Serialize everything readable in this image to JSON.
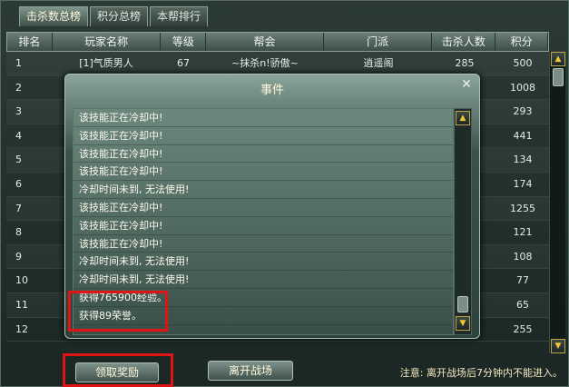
{
  "tabs": [
    {
      "label": "击杀数总榜",
      "active": true
    },
    {
      "label": "积分总榜",
      "active": false
    },
    {
      "label": "本帮排行",
      "active": false
    }
  ],
  "table": {
    "headers": [
      "排名",
      "玩家名称",
      "等级",
      "帮会",
      "门派",
      "击杀人数",
      "积分"
    ],
    "rows": [
      [
        "1",
        "[1]气质男人",
        "67",
        "~抹杀n!骄傲~",
        "逍遥阁",
        "285",
        "500"
      ],
      [
        "2",
        "",
        "",
        "",
        "",
        "",
        "1008"
      ],
      [
        "3",
        "",
        "",
        "",
        "",
        "",
        "293"
      ],
      [
        "4",
        "",
        "",
        "",
        "",
        "",
        "441"
      ],
      [
        "5",
        "",
        "",
        "",
        "",
        "",
        "134"
      ],
      [
        "6",
        "",
        "",
        "",
        "",
        "",
        "174"
      ],
      [
        "7",
        "",
        "",
        "",
        "",
        "",
        "1255"
      ],
      [
        "8",
        "",
        "",
        "",
        "",
        "",
        "121"
      ],
      [
        "9",
        "",
        "",
        "",
        "",
        "",
        "108"
      ],
      [
        "10",
        "",
        "",
        "",
        "",
        "",
        "77"
      ],
      [
        "11",
        "",
        "",
        "",
        "",
        "",
        "65"
      ],
      [
        "12",
        "",
        "",
        "",
        "",
        "",
        "255"
      ]
    ]
  },
  "modal": {
    "title": "事件",
    "close_icon": "close-icon",
    "messages": [
      "该技能正在冷却中!",
      "该技能正在冷却中!",
      "该技能正在冷却中!",
      "该技能正在冷却中!",
      "冷却时间未到, 无法使用!",
      "该技能正在冷却中!",
      "该技能正在冷却中!",
      "该技能正在冷却中!",
      "冷却时间未到, 无法使用!",
      "冷却时间未到, 无法使用!",
      "获得765900经验。",
      "获得89荣誉。"
    ]
  },
  "buttons": {
    "claim_reward": "领取奖励",
    "leave_battle": "离开战场"
  },
  "notice": "注意: 离开战场后7分钟内不能进入。",
  "colors": {
    "highlight": "#e01414",
    "accent_gold": "#f2c437"
  }
}
